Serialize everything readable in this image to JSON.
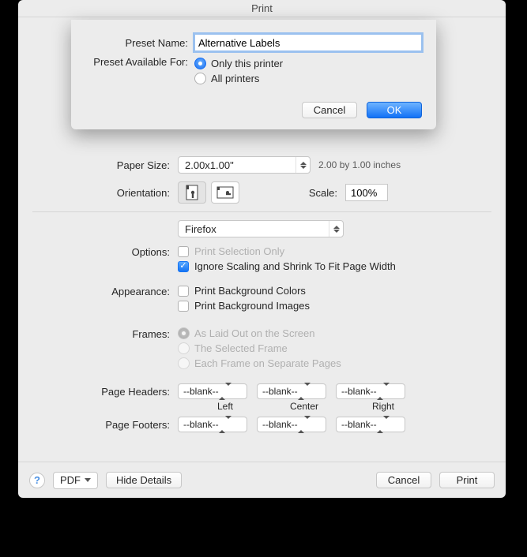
{
  "title": "Print",
  "sheet": {
    "preset_name_label": "Preset Name:",
    "preset_name_value": "Alternative Labels",
    "available_label": "Preset Available For:",
    "radio_only": "Only this printer",
    "radio_all": "All printers",
    "cancel": "Cancel",
    "ok": "OK"
  },
  "paper": {
    "label": "Paper Size:",
    "value": "2.00x1.00\"",
    "hint": "2.00 by 1.00 inches"
  },
  "orientation": {
    "label": "Orientation:"
  },
  "scale": {
    "label": "Scale:",
    "value": "100%"
  },
  "app_select": "Firefox",
  "options": {
    "label": "Options:",
    "print_selection": "Print Selection Only",
    "ignore_scaling": "Ignore Scaling and Shrink To Fit Page Width"
  },
  "appearance": {
    "label": "Appearance:",
    "bg_colors": "Print Background Colors",
    "bg_images": "Print Background Images"
  },
  "frames": {
    "label": "Frames:",
    "as_laid": "As Laid Out on the Screen",
    "selected": "The Selected Frame",
    "each": "Each Frame on Separate Pages"
  },
  "headers_label": "Page Headers:",
  "footers_label": "Page Footers:",
  "blank": "--blank--",
  "cols": {
    "left": "Left",
    "center": "Center",
    "right": "Right"
  },
  "footer": {
    "pdf": "PDF",
    "hide": "Hide Details",
    "cancel": "Cancel",
    "print": "Print"
  }
}
